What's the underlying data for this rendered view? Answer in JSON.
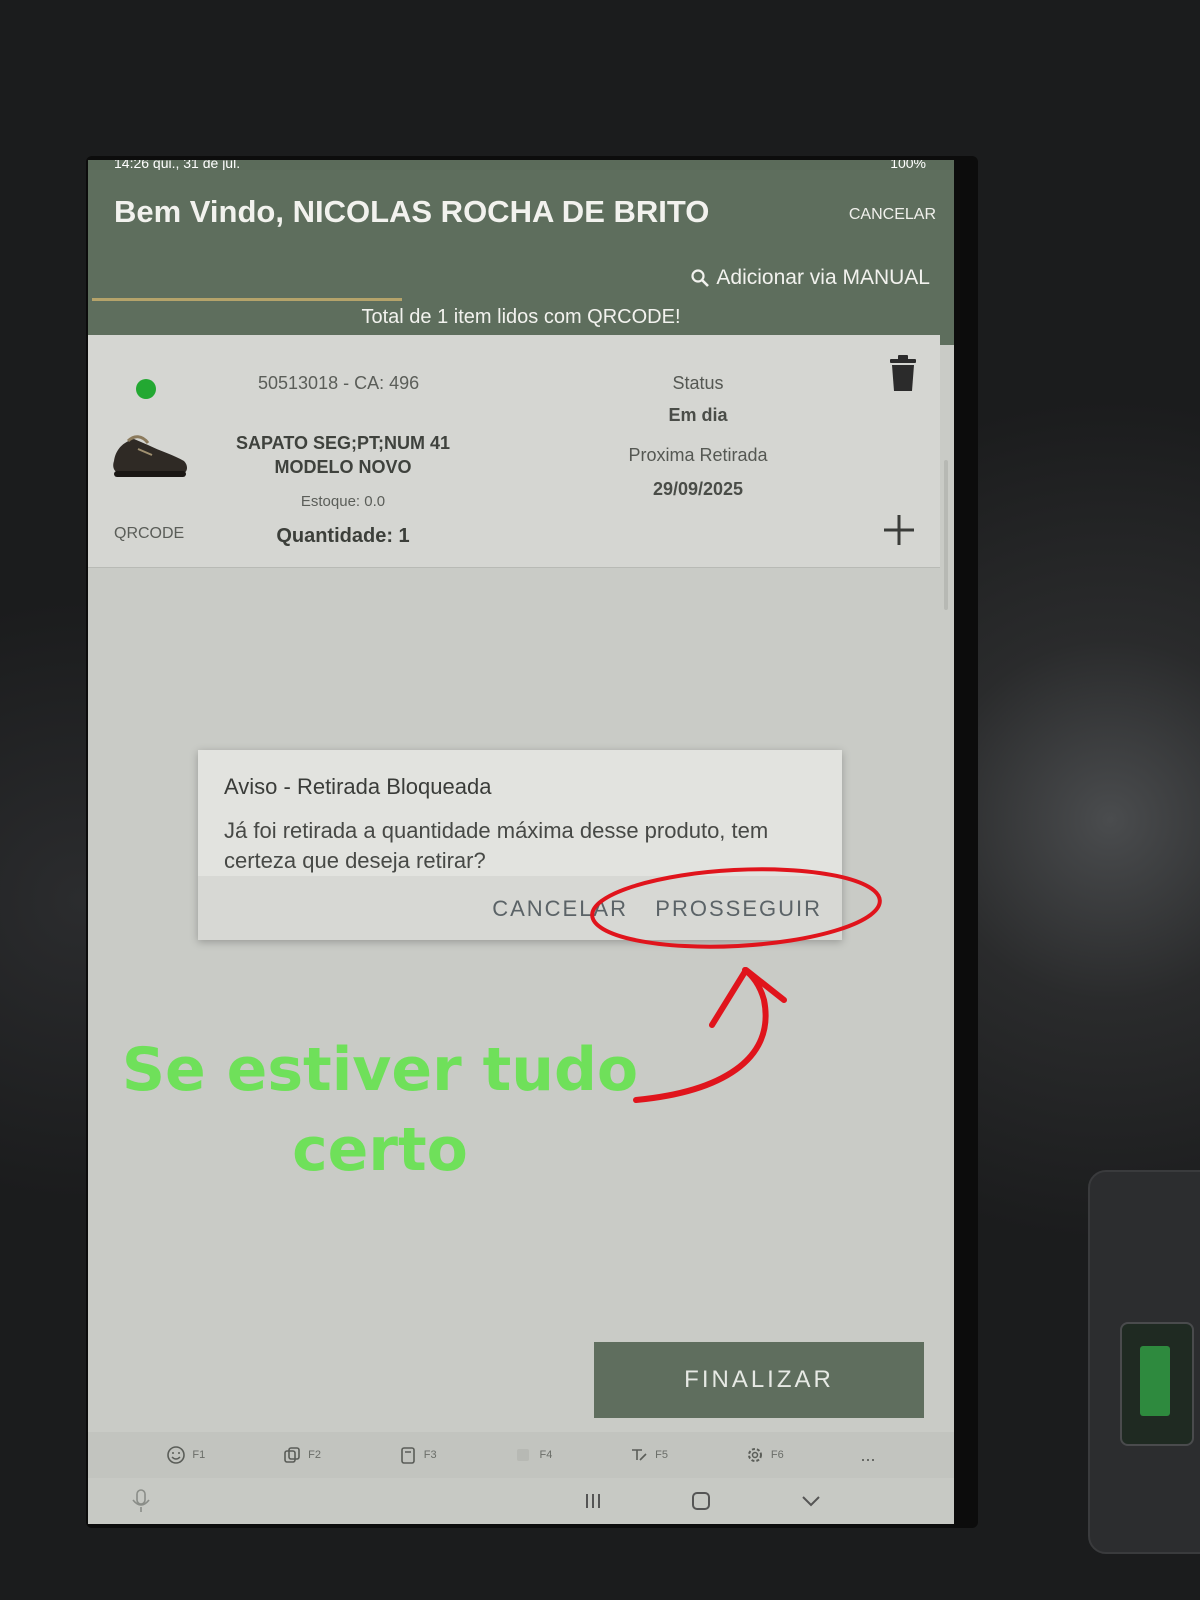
{
  "statusbar": {
    "time": "14:26  qui., 31 de jul.",
    "battery": "100%"
  },
  "header": {
    "welcome": "Bem Vindo, NICOLAS  ROCHA DE BRITO",
    "cancel": "CANCELAR",
    "add_manual": "Adicionar via MANUAL",
    "total": "Total de 1 item lidos com QRCODE!"
  },
  "item": {
    "code": "50513018 - CA: 496",
    "name": "SAPATO SEG;PT;NUM 41 MODELO NOVO",
    "stock": "Estoque: 0.0",
    "quantity": "Quantidade: 1",
    "source": "QRCODE",
    "status_label": "Status",
    "status_value": "Em dia",
    "next_label": "Proxima Retirada",
    "next_value": "29/09/2025",
    "status_color": "#23a832"
  },
  "dialog": {
    "title": "Aviso - Retirada Bloqueada",
    "message": "Já foi retirada a quantidade máxima desse produto, tem certeza que deseja retirar?",
    "cancel": "CANCELAR",
    "proceed": "PROSSEGUIR"
  },
  "finalizar": "FINALIZAR",
  "fkeys": [
    {
      "label": "F1",
      "icon": "smiley-icon"
    },
    {
      "label": "F2",
      "icon": "copy-icon"
    },
    {
      "label": "F3",
      "icon": "clipboard-icon"
    },
    {
      "label": "F4",
      "icon": "blank-icon"
    },
    {
      "label": "F5",
      "icon": "handwriting-icon"
    },
    {
      "label": "F6",
      "icon": "gear-icon"
    },
    {
      "label": "...",
      "icon": "more-icon"
    }
  ],
  "annotation": {
    "text": "Se estiver tudo certo",
    "color": "#6fe05a",
    "circle_color": "#e0141c"
  }
}
